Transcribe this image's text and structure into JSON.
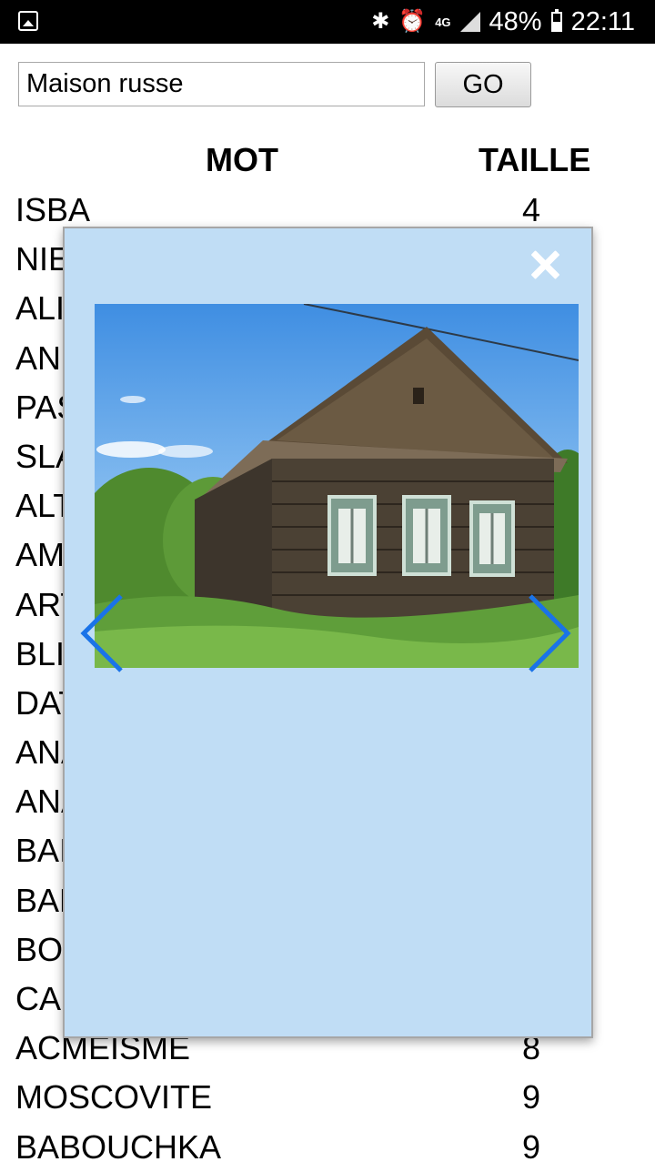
{
  "status_bar": {
    "battery": "48%",
    "time": "22:11",
    "network": "4G"
  },
  "search": {
    "value": "Maison russe",
    "button_label": "GO"
  },
  "table": {
    "headers": {
      "word": "MOT",
      "size": "TAILLE"
    },
    "rows": [
      {
        "word": "ISBA",
        "size": "4"
      },
      {
        "word": "NIE",
        "size": ""
      },
      {
        "word": "ALI",
        "size": ""
      },
      {
        "word": "ANI",
        "size": ""
      },
      {
        "word": "PAS",
        "size": ""
      },
      {
        "word": "SLA",
        "size": ""
      },
      {
        "word": "ALT",
        "size": ""
      },
      {
        "word": "AM",
        "size": ""
      },
      {
        "word": "ART",
        "size": ""
      },
      {
        "word": "BLI",
        "size": ""
      },
      {
        "word": "DAT",
        "size": ""
      },
      {
        "word": "ANA",
        "size": ""
      },
      {
        "word": "ANA",
        "size": ""
      },
      {
        "word": "BAI",
        "size": ""
      },
      {
        "word": "BAF",
        "size": ""
      },
      {
        "word": "BOI",
        "size": ""
      },
      {
        "word": "CAL",
        "size": ""
      },
      {
        "word": "ACMEISME",
        "size": "8"
      },
      {
        "word": "MOSCOVITE",
        "size": "9"
      },
      {
        "word": "BABOUCHKA",
        "size": "9"
      }
    ]
  },
  "modal": {
    "background": "#c0ddf5",
    "accent": "#1a73e8",
    "icons": {
      "close": "close-icon",
      "prev": "chevron-left-icon",
      "next": "chevron-right-icon"
    }
  }
}
